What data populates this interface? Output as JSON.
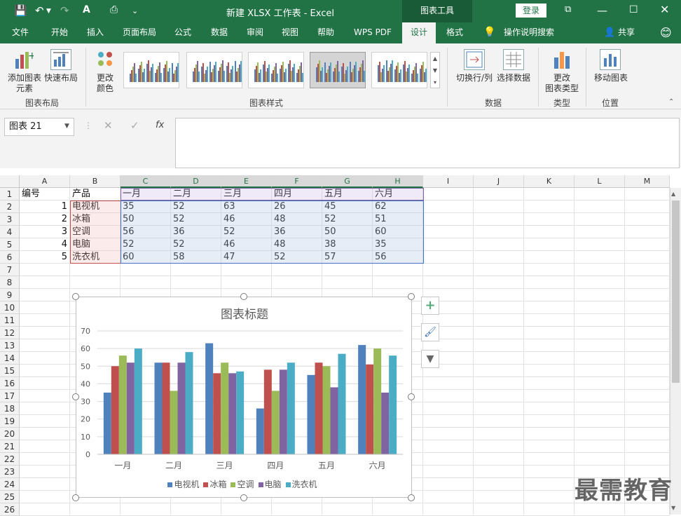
{
  "window": {
    "title": "新建 XLSX 工作表  -  Excel",
    "context_tool": "图表工具",
    "login": "登录"
  },
  "tabs": [
    "文件",
    "开始",
    "插入",
    "页面布局",
    "公式",
    "数据",
    "审阅",
    "视图",
    "帮助",
    "WPS PDF",
    "设计",
    "格式"
  ],
  "active_tab": "设计",
  "tell_me": "操作说明搜索",
  "share": "共享",
  "ribbon": {
    "add_element_1": "添加图表",
    "add_element_2": "元素",
    "quick_layout": "快速布局",
    "group_layout": "图表布局",
    "change_colors_1": "更改",
    "change_colors_2": "颜色",
    "group_styles": "图表样式",
    "switch_row_col": "切换行/列",
    "select_data": "选择数据",
    "group_data": "数据",
    "change_type_1": "更改",
    "change_type_2": "图表类型",
    "group_type": "类型",
    "move_chart": "移动图表",
    "group_location": "位置"
  },
  "formula_bar": {
    "name_box": "图表 21",
    "fx": "fx",
    "value": ""
  },
  "columns": [
    "A",
    "B",
    "C",
    "D",
    "E",
    "F",
    "G",
    "H",
    "I",
    "J",
    "K",
    "L",
    "M"
  ],
  "rows": [
    "1",
    "2",
    "3",
    "4",
    "5",
    "6",
    "7",
    "8",
    "9",
    "10",
    "11",
    "12",
    "13",
    "14",
    "15",
    "16",
    "17",
    "18",
    "19",
    "20",
    "21",
    "22",
    "23",
    "24",
    "25",
    "26"
  ],
  "table": {
    "headers": [
      "编号",
      "产品",
      "一月",
      "二月",
      "三月",
      "四月",
      "五月",
      "六月"
    ],
    "rows": [
      [
        "1",
        "电视机",
        "35",
        "52",
        "63",
        "26",
        "45",
        "62"
      ],
      [
        "2",
        "冰箱",
        "50",
        "52",
        "46",
        "48",
        "52",
        "51"
      ],
      [
        "3",
        "空调",
        "56",
        "36",
        "52",
        "36",
        "50",
        "60"
      ],
      [
        "4",
        "电脑",
        "52",
        "52",
        "46",
        "48",
        "38",
        "35"
      ],
      [
        "5",
        "洗衣机",
        "60",
        "58",
        "47",
        "52",
        "57",
        "56"
      ]
    ]
  },
  "chart_data": {
    "type": "bar",
    "title": "图表标题",
    "categories": [
      "一月",
      "二月",
      "三月",
      "四月",
      "五月",
      "六月"
    ],
    "series": [
      {
        "name": "电视机",
        "values": [
          35,
          52,
          63,
          26,
          45,
          62
        ],
        "color": "#4f81bd"
      },
      {
        "name": "冰箱",
        "values": [
          50,
          52,
          46,
          48,
          52,
          51
        ],
        "color": "#c0504d"
      },
      {
        "name": "空调",
        "values": [
          56,
          36,
          52,
          36,
          50,
          60
        ],
        "color": "#9bbb59"
      },
      {
        "name": "电脑",
        "values": [
          52,
          52,
          46,
          48,
          38,
          35
        ],
        "color": "#8064a2"
      },
      {
        "name": "洗衣机",
        "values": [
          60,
          58,
          47,
          52,
          57,
          56
        ],
        "color": "#4bacc6"
      }
    ],
    "ylim": [
      0,
      70
    ],
    "yticks": [
      0,
      10,
      20,
      30,
      40,
      50,
      60,
      70
    ],
    "grid": true,
    "legend": "bottom"
  },
  "watermark": "最需教育",
  "colors": {
    "accent": "#217346"
  }
}
